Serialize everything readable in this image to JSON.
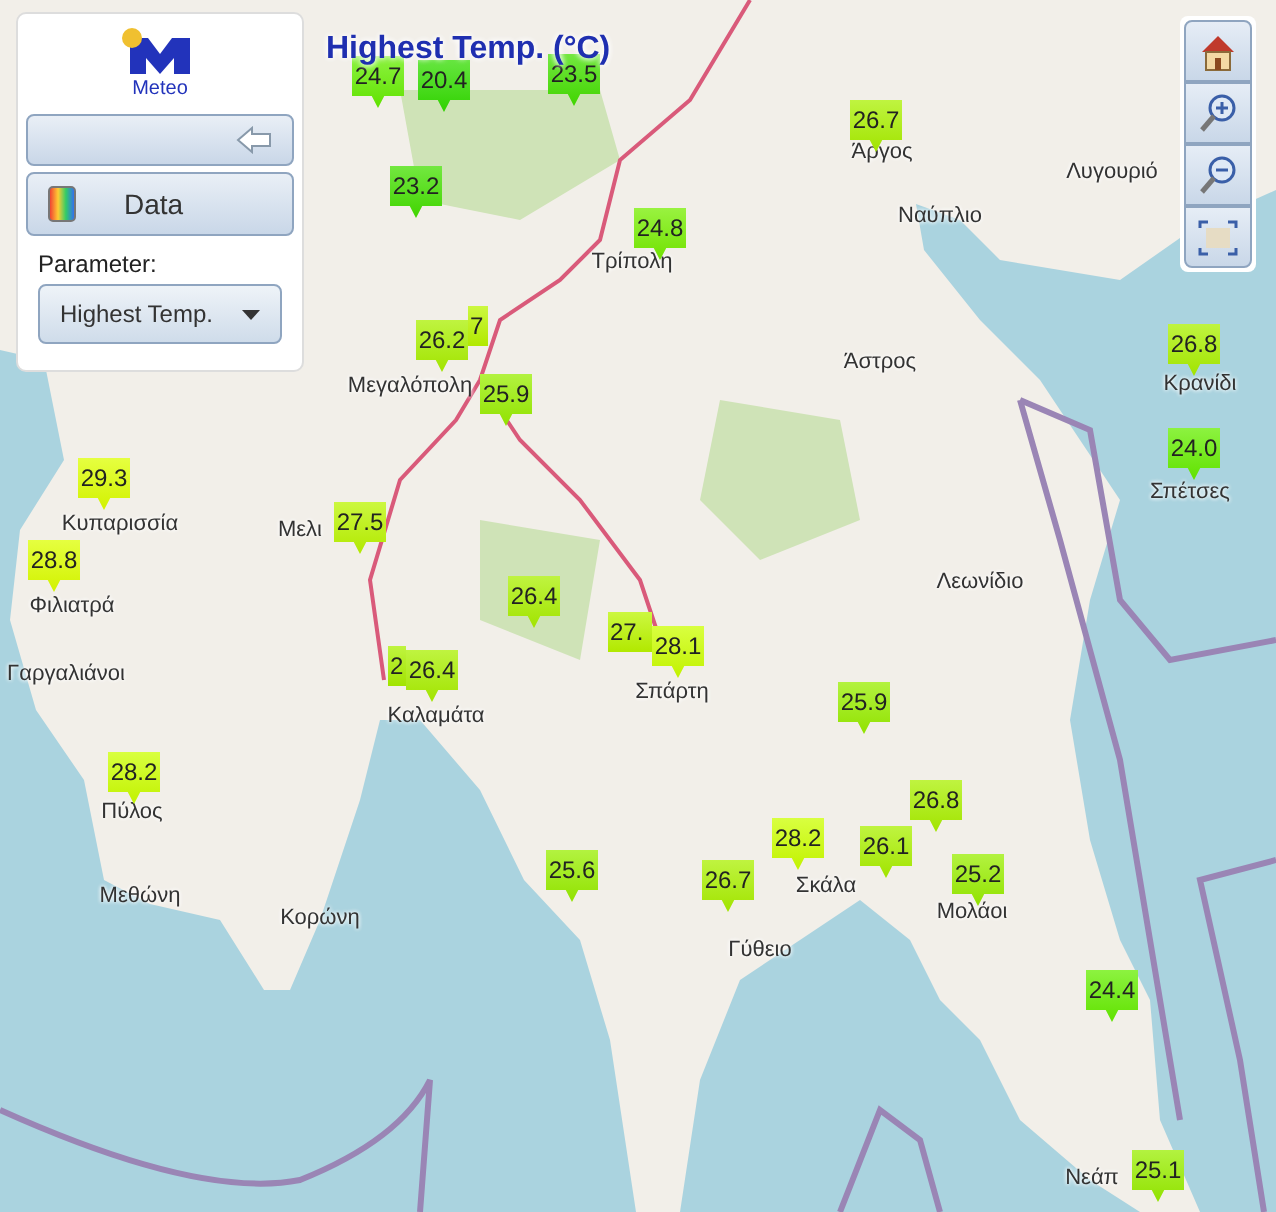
{
  "map": {
    "title": "Highest Temp. (°C)",
    "places": [
      {
        "name": "Άργος"
      },
      {
        "name": "Ναύπλιο"
      },
      {
        "name": "Λυγουριό"
      },
      {
        "name": "Τρίπολη"
      },
      {
        "name": "Άστρος"
      },
      {
        "name": "Κρανίδι"
      },
      {
        "name": "Σπέτσες"
      },
      {
        "name": "Μεγαλόπολη"
      },
      {
        "name": "Κυπαρισσία"
      },
      {
        "name": "Φιλιατρά"
      },
      {
        "name": "Μελι"
      },
      {
        "name": "Γαργαλιάνοι"
      },
      {
        "name": "Καλαμάτα"
      },
      {
        "name": "Σπάρτη"
      },
      {
        "name": "Λεωνίδιο"
      },
      {
        "name": "Πύλος"
      },
      {
        "name": "Μεθώνη"
      },
      {
        "name": "Κορώνη"
      },
      {
        "name": "Γύθειο"
      },
      {
        "name": "Σκάλα"
      },
      {
        "name": "Μολάοι"
      },
      {
        "name": "Νεάπ"
      }
    ],
    "markers": [
      {
        "value": "24.7",
        "color": "#66ee00"
      },
      {
        "value": "20.4",
        "color": "#33dd00"
      },
      {
        "value": "23.5",
        "color": "#44e000"
      },
      {
        "value": "26.7",
        "color": "#aaf000"
      },
      {
        "value": "23.2",
        "color": "#44e000"
      },
      {
        "value": "24.8",
        "color": "#77ee00"
      },
      {
        "value": "7",
        "color": "#bbf500"
      },
      {
        "value": "26.2",
        "color": "#aaf000"
      },
      {
        "value": "25.9",
        "color": "#99ee00"
      },
      {
        "value": "26.8",
        "color": "#aaf000"
      },
      {
        "value": "24.0",
        "color": "#66ee00"
      },
      {
        "value": "29.3",
        "color": "#ddff00"
      },
      {
        "value": "28.8",
        "color": "#ddff00"
      },
      {
        "value": "27.5",
        "color": "#bbf500"
      },
      {
        "value": "26.4",
        "color": "#aaf000"
      },
      {
        "value": "27.",
        "color": "#bbf500"
      },
      {
        "value": "28.1",
        "color": "#ccff00"
      },
      {
        "value": "2",
        "color": "#aaf000"
      },
      {
        "value": "26.4",
        "color": "#aaf000"
      },
      {
        "value": "25.9",
        "color": "#99ee00"
      },
      {
        "value": "28.2",
        "color": "#ccff00"
      },
      {
        "value": "26.8",
        "color": "#aaf000"
      },
      {
        "value": "28.2",
        "color": "#ccff00"
      },
      {
        "value": "26.1",
        "color": "#aaf000"
      },
      {
        "value": "25.6",
        "color": "#99ee00"
      },
      {
        "value": "26.7",
        "color": "#aaf000"
      },
      {
        "value": "25.2",
        "color": "#99ee00"
      },
      {
        "value": "24.4",
        "color": "#66ee00"
      },
      {
        "value": "25.1",
        "color": "#99ee00"
      }
    ]
  },
  "panel": {
    "logo_text": "Meteo",
    "data_button": "Data",
    "parameter_label": "Parameter:",
    "parameter_value": "Highest Temp."
  }
}
